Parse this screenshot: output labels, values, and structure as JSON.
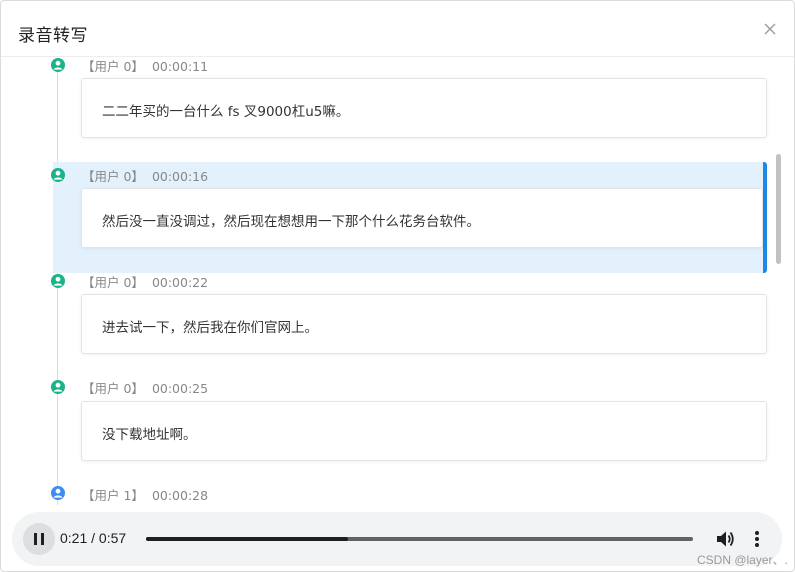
{
  "dialog": {
    "title": "录音转写"
  },
  "transcript": [
    {
      "user": "【用户 0】",
      "time": "00:00:11",
      "text": "二二年买的一台什么 fs 叉9000杠u5嘛。"
    },
    {
      "user": "【用户 0】",
      "time": "00:00:16",
      "text": "然后没一直没调过，然后现在想想用一下那个什么花务台软件。"
    },
    {
      "user": "【用户 0】",
      "time": "00:00:22",
      "text": "进去试一下，然后我在你们官网上。"
    },
    {
      "user": "【用户 0】",
      "time": "00:00:25",
      "text": "没下载地址啊。"
    },
    {
      "user": "【用户 1】",
      "time": "00:00:28",
      "text": ""
    }
  ],
  "colors": {
    "user0_icon": "#1bb38a",
    "user1_icon": "#3b8ef0",
    "active_bg": "#e3f1fc",
    "active_border": "#1e88e5"
  },
  "player": {
    "current": "0:21",
    "duration": "0:57",
    "time_display": "0:21 / 0:57",
    "progress": 0.3684,
    "state": "playing"
  },
  "watermark": "CSDN @layer、."
}
